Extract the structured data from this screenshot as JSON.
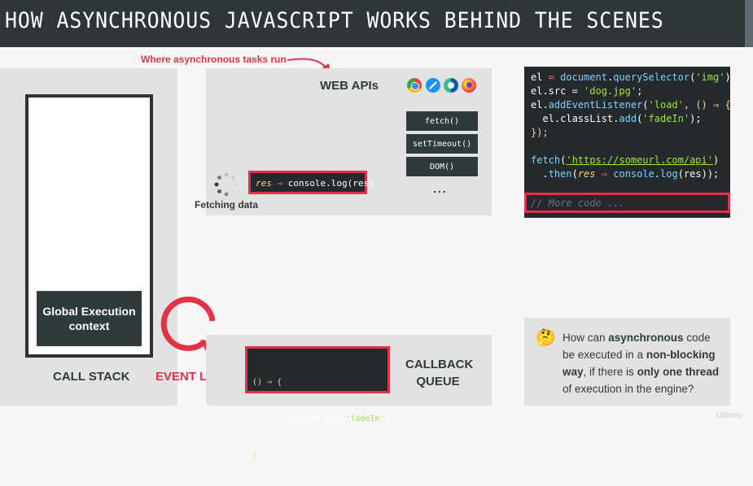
{
  "header": {
    "title": "HOW ASYNCHRONOUS JAVASCRIPT WORKS BEHIND THE SCENES"
  },
  "annotation": {
    "text": "Where asynchronous tasks run"
  },
  "web_apis": {
    "title": "WEB APIs",
    "browsers": [
      "chrome-icon",
      "safari-icon",
      "edge-icon",
      "firefox-icon"
    ],
    "items": [
      "fetch()",
      "setTimeout()",
      "DOM()"
    ],
    "more": "...",
    "callback_code": {
      "p1": "res",
      "arrow": " ⇒ ",
      "p2": "console.log(res)"
    },
    "status": "Fetching data"
  },
  "call_stack": {
    "context": "Global Execution context",
    "label": "CALL STACK"
  },
  "event_loop": {
    "label": "EVENT LOOP"
  },
  "callback_queue": {
    "label_line1": "CALLBACK",
    "label_line2": "QUEUE",
    "code": {
      "l1": "() ⇒ {",
      "l2a": "  el.classList.add(",
      "l2b": "'fadeIn'",
      "l2c": ");",
      "l3": "}"
    }
  },
  "code_editor": {
    "l1a": "el",
    "l1b": " = ",
    "l1c": "document",
    "l1d": ".",
    "l1e": "querySelector",
    "l1f": "(",
    "l1g": "'img'",
    "l1h": ");",
    "l2a": "el",
    "l2b": ".src = ",
    "l2c": "'dog.jpg'",
    "l2d": ";",
    "l3a": "el",
    "l3b": ".",
    "l3c": "addEventListener",
    "l3d": "(",
    "l3e": "'load'",
    "l3f": ", () ⇒ {",
    "l4a": "  el.classList.",
    "l4b": "add",
    "l4c": "(",
    "l4d": "'fadeIn'",
    "l4e": ");",
    "l5": "});",
    "l6a": "fetch",
    "l6b": "(",
    "l6c": "'https://someurl.com/api'",
    "l6d": ")",
    "l7a": "  .",
    "l7b": "then",
    "l7c": "(",
    "l7d": "res",
    "l7e": " ⇒ ",
    "l7f": "console",
    "l7g": ".",
    "l7h": "log",
    "l7i": "(res));",
    "comment": "// More code ..."
  },
  "question": {
    "emoji": "🤔",
    "t1": "How can ",
    "t2": "asynchronous",
    "t3": " code be executed in a ",
    "t4": "non-blocking way",
    "t5": ", if there is ",
    "t6": "only one thread",
    "t7": " of execution in the engine?"
  },
  "watermark": "Udemy",
  "colors": {
    "accent": "#e0334a",
    "dark": "#2f3a3c",
    "panel": "#e2e2e2",
    "code_bg": "#23292c"
  }
}
